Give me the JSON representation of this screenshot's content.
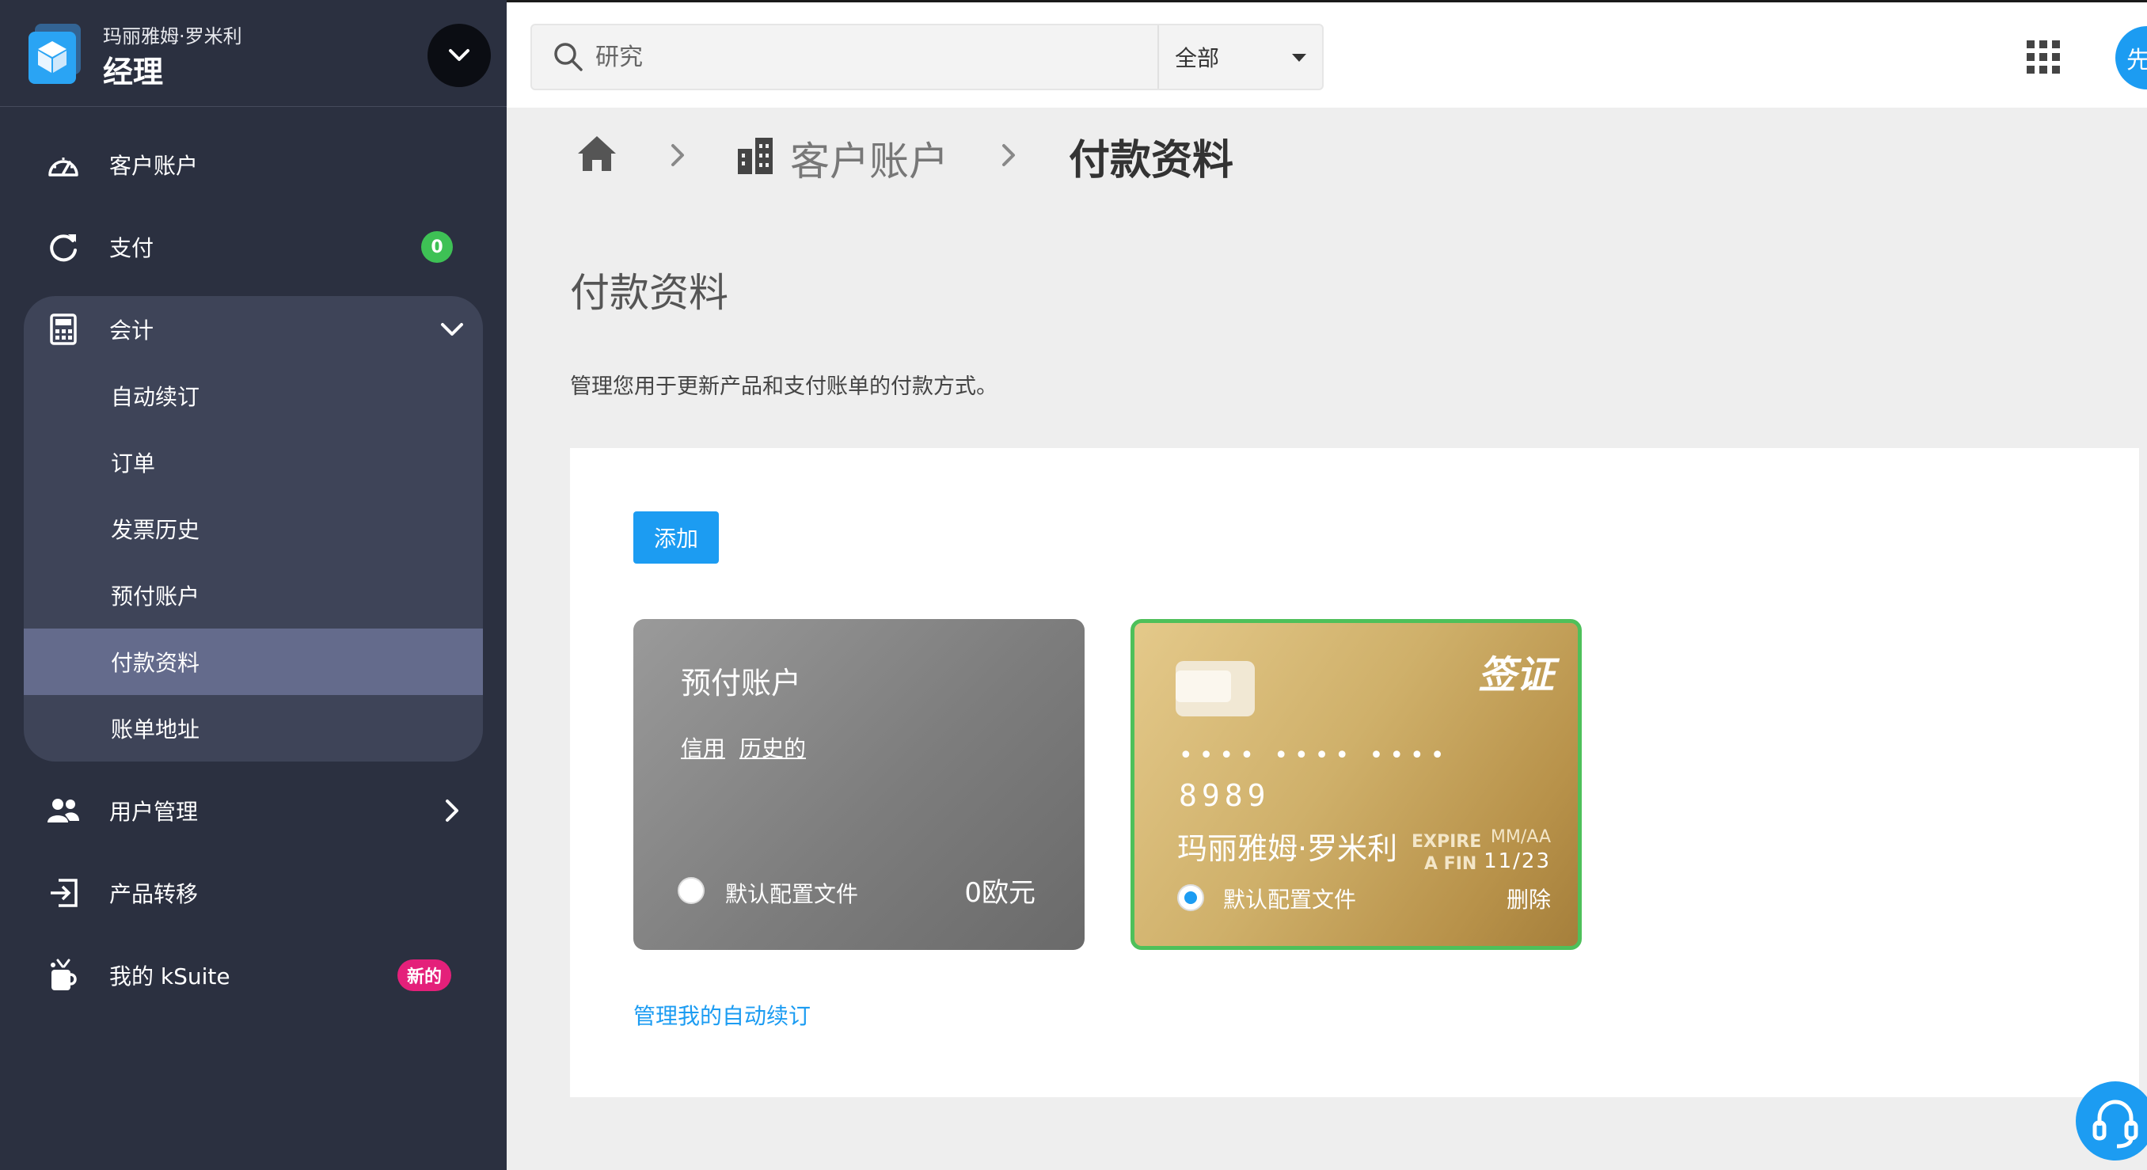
{
  "sidebar": {
    "org_name": "玛丽雅姆·罗米利",
    "app_name": "经理",
    "nav": {
      "customer_account": "客户账户",
      "payment": "支付",
      "payment_badge": "0",
      "accounting": "会计",
      "user_management": "用户管理",
      "product_transfer": "产品转移",
      "my_ksuite": "我的 kSuite",
      "ksuite_badge": "新的"
    },
    "accounting_items": {
      "auto_renewal": "自动续订",
      "orders": "订单",
      "invoice_history": "发票历史",
      "prepaid_account": "预付账户",
      "payment_profiles": "付款资料",
      "billing_address": "账单地址"
    }
  },
  "topbar": {
    "search_placeholder": "研究",
    "scope_value": "全部",
    "avatar_text": "先"
  },
  "breadcrumb": {
    "parent": "客户账户",
    "current": "付款资料"
  },
  "page": {
    "title": "付款资料",
    "description": "管理您用于更新产品和支付账单的付款方式。",
    "add_label": "添加",
    "manage_link": "管理我的自动续订"
  },
  "prepaid_card": {
    "title": "预付账户",
    "link_credit": "信用",
    "link_history": "历史的",
    "default_label": "默认配置文件",
    "balance": "0欧元"
  },
  "visa_card": {
    "brand": "签证",
    "masked_groups": "•••• •••• ••••",
    "last4": "8989",
    "holder": "玛丽雅姆·罗米利",
    "expire_label_1": "EXPIRE",
    "expire_label_2": "A FIN",
    "expire_format": "MM/AA",
    "expire_date": "11/23",
    "default_label": "默认配置文件",
    "delete_label": "删除"
  },
  "colors": {
    "sidebar_bg": "#2b3040",
    "accent": "#1c9cf2",
    "active_item": "#646b8c",
    "selected_border": "#4ec05a",
    "badge_green": "#3ec155",
    "badge_pink": "#e4207a"
  }
}
